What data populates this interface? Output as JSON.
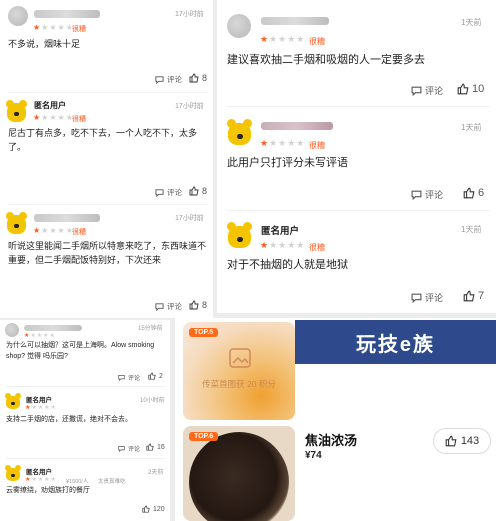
{
  "left_top": {
    "reviews": [
      {
        "name_hidden": true,
        "time": "17小时前",
        "rating_label": "很糟",
        "text": "不多说，烟味十足",
        "comment_label": "评论",
        "likes": "8"
      },
      {
        "name": "匿名用户",
        "time": "17小时前",
        "rating_label": "很糟",
        "text": "尼古丁有点多，吃不下去，一个人吃不下，太多了。",
        "comment_label": "评论",
        "likes": "8"
      },
      {
        "name_hidden": true,
        "time": "17小时前",
        "rating_label": "很糟",
        "text": "听说这里能闻二手烟所以特意来吃了，东西味道不重要，但二手烟配饭特别好，下次还来",
        "comment_label": "评论",
        "likes": "8"
      }
    ]
  },
  "right_top": {
    "reviews": [
      {
        "name_hidden": true,
        "time": "1天前",
        "rating_label": "很糟",
        "text": "建议喜欢抽二手烟和吸烟的人一定要多去",
        "comment_label": "评论",
        "likes": "10"
      },
      {
        "name_hidden": true,
        "time": "1天前",
        "rating_label": "很糟",
        "text": "此用户只打评分未写评语",
        "comment_label": "评论",
        "likes": "6"
      },
      {
        "name": "匿名用户",
        "time": "1天前",
        "rating_label": "很糟",
        "text": "对于不抽烟的人就是地狱",
        "comment_label": "评论",
        "likes": "7"
      }
    ]
  },
  "left_bottom": {
    "reviews": [
      {
        "name_hidden": true,
        "time": "15分钟前",
        "text": "为什么可以抽烟？这可是上海啊。Alow smoking shop? 觉得 吗乐园?",
        "comment_label": "评论",
        "likes": "2"
      },
      {
        "name": "匿名用户",
        "time": "10小时前",
        "text": "支持二手烟的店，还撒谎，绝对不会去。",
        "comment_label": "评论",
        "likes": "16"
      },
      {
        "name": "匿名用户",
        "price": "¥1000/人",
        "extra": "太贵真难吃",
        "time": "2天前",
        "text": "云雾缭绕，劝烟族打的餐厅",
        "likes": "120"
      }
    ]
  },
  "right_bottom": {
    "brand": "玩技e族",
    "items": [
      {
        "badge": "TOP.5",
        "caption": "传菜首图获 20 积分"
      },
      {
        "badge": "TOP.6",
        "dish": "焦油浓汤",
        "price": "¥74",
        "likes": "143"
      }
    ]
  },
  "colors": {
    "accent": "#ff5a1f",
    "brand_bg": "#2e4a8c",
    "top_badge": "#ff6a1a"
  }
}
